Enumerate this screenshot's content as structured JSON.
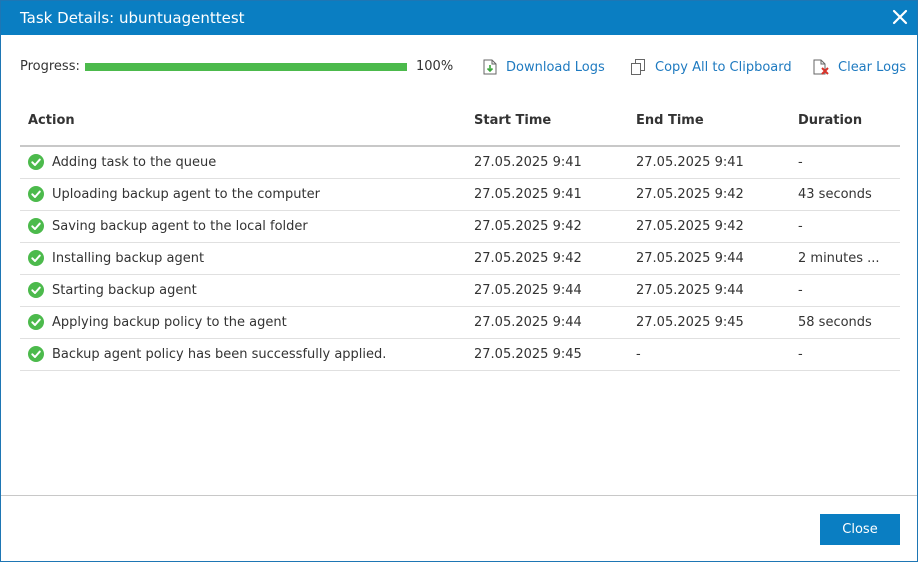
{
  "dialog": {
    "title": "Task Details: ubuntuagenttest",
    "close_icon": "close-icon"
  },
  "progress": {
    "label": "Progress:",
    "value": 100,
    "percent_text": "100%",
    "fill_color": "#4cba4c"
  },
  "toolbar": {
    "download_logs": "Download Logs",
    "copy_all": "Copy All to Clipboard",
    "clear_logs": "Clear Logs"
  },
  "table": {
    "headers": {
      "action": "Action",
      "start_time": "Start Time",
      "end_time": "End Time",
      "duration": "Duration"
    },
    "rows": [
      {
        "action": "Adding task to the queue",
        "start": "27.05.2025 9:41",
        "end": "27.05.2025 9:41",
        "duration": "-"
      },
      {
        "action": "Uploading backup agent to the computer",
        "start": "27.05.2025 9:41",
        "end": "27.05.2025 9:42",
        "duration": "43 seconds"
      },
      {
        "action": "Saving backup agent to the local folder",
        "start": "27.05.2025 9:42",
        "end": "27.05.2025 9:42",
        "duration": "-"
      },
      {
        "action": "Installing backup agent",
        "start": "27.05.2025 9:42",
        "end": "27.05.2025 9:44",
        "duration": "2 minutes ..."
      },
      {
        "action": "Starting backup agent",
        "start": "27.05.2025 9:44",
        "end": "27.05.2025 9:44",
        "duration": "-"
      },
      {
        "action": "Applying backup policy to the agent",
        "start": "27.05.2025 9:44",
        "end": "27.05.2025 9:45",
        "duration": "58 seconds"
      },
      {
        "action": "Backup agent policy has been successfully applied.",
        "start": "27.05.2025 9:45",
        "end": "-",
        "duration": "-"
      }
    ],
    "status_icon": "success-check-icon",
    "status_color": "#4cba4c"
  },
  "footer": {
    "close_label": "Close"
  },
  "colors": {
    "accent": "#0a7ec2",
    "link": "#1e7ac0"
  }
}
